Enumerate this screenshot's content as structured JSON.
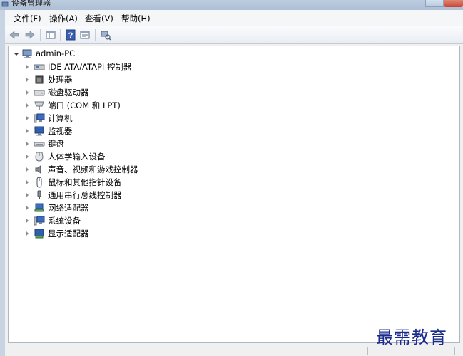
{
  "window": {
    "title": "设备管理器"
  },
  "menu": [
    {
      "label": "文件(F)"
    },
    {
      "label": "操作(A)"
    },
    {
      "label": "查看(V)"
    },
    {
      "label": "帮助(H)"
    }
  ],
  "toolbar": {
    "buttons": [
      "back-icon",
      "forward-icon",
      "console-tree-icon",
      "help-icon",
      "properties-icon",
      "scan-hardware-icon"
    ]
  },
  "tree": {
    "root": "admin-PC",
    "items": [
      {
        "label": "IDE ATA/ATAPI 控制器",
        "icon": "ide-controller-icon"
      },
      {
        "label": "处理器",
        "icon": "processor-icon"
      },
      {
        "label": "磁盘驱动器",
        "icon": "disk-drive-icon"
      },
      {
        "label": "端口 (COM 和 LPT)",
        "icon": "port-icon"
      },
      {
        "label": "计算机",
        "icon": "computer-icon"
      },
      {
        "label": "监视器",
        "icon": "monitor-icon"
      },
      {
        "label": "键盘",
        "icon": "keyboard-icon"
      },
      {
        "label": "人体学输入设备",
        "icon": "hid-icon"
      },
      {
        "label": "声音、视频和游戏控制器",
        "icon": "sound-icon"
      },
      {
        "label": "鼠标和其他指针设备",
        "icon": "mouse-icon"
      },
      {
        "label": "通用串行总线控制器",
        "icon": "usb-icon"
      },
      {
        "label": "网络适配器",
        "icon": "network-adapter-icon"
      },
      {
        "label": "系统设备",
        "icon": "system-device-icon"
      },
      {
        "label": "显示适配器",
        "icon": "display-adapter-icon"
      }
    ]
  },
  "watermark": "最需教育"
}
